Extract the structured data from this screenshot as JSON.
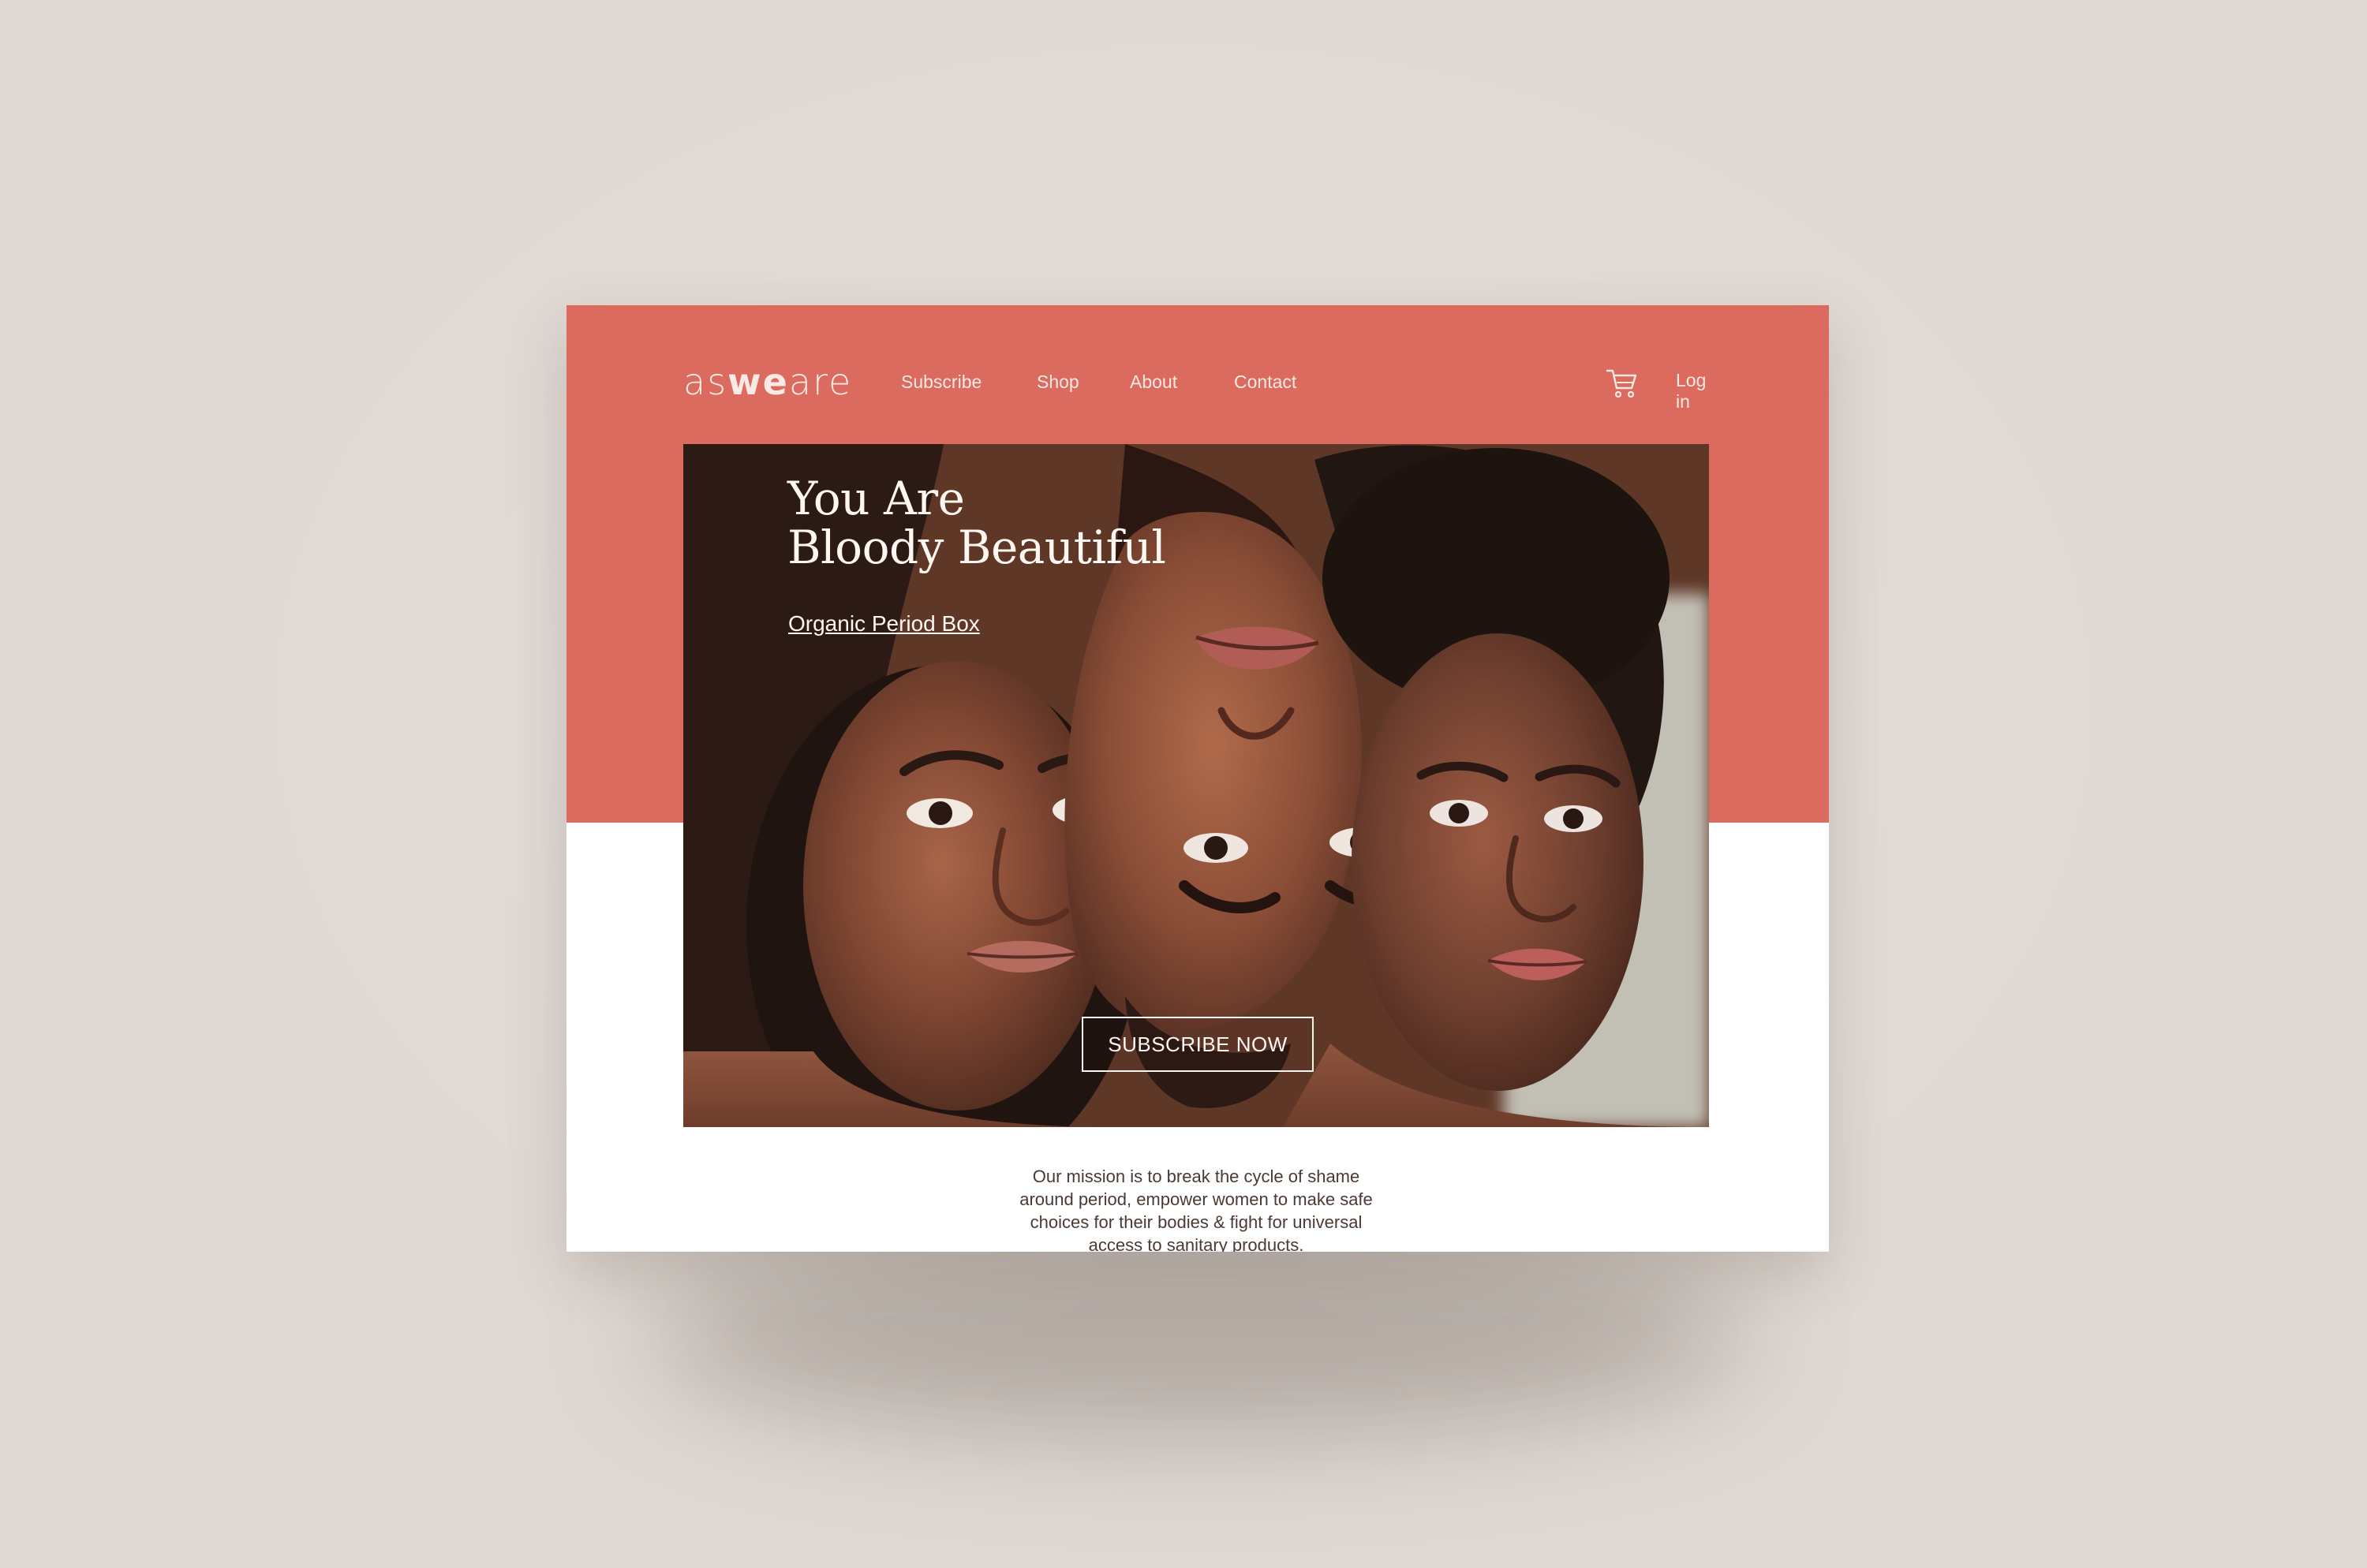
{
  "site": {
    "brand": {
      "light_part_1": "as",
      "bold_part": "we",
      "light_part_2": "are"
    },
    "nav": {
      "items": [
        {
          "label": "Subscribe"
        },
        {
          "label": "Shop"
        },
        {
          "label": "About"
        },
        {
          "label": "Contact"
        }
      ],
      "login_label": "Log in",
      "cart_icon": "cart-icon"
    },
    "hero": {
      "title_line_1": "You Are",
      "title_line_2": "Bloody Beautiful",
      "link_text": "Organic Period Box",
      "cta_label": "SUBSCRIBE NOW"
    },
    "mission": {
      "text": "Our mission is to break the cycle of shame around period, empower women to make safe choices for their bodies & fight for universal access to sanitary products."
    },
    "colors": {
      "background": "#e0d9d3",
      "brand_coral": "#db6a5f",
      "page_white": "#ffffff",
      "text_light": "#fbe9e4",
      "text_dark": "#4a3a34"
    }
  }
}
